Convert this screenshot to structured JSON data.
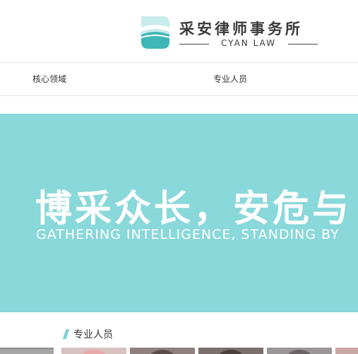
{
  "logo": {
    "name_cn": "采安律师事务所",
    "name_en": "CYAN LAW",
    "colors": {
      "mark_light": "#c8ebeb",
      "mark_dark": "#3fb7b6"
    }
  },
  "nav": {
    "items": [
      {
        "label": "核心领域"
      },
      {
        "label": "专业人员"
      }
    ]
  },
  "banner": {
    "title_cn": "博采众长，安危与",
    "title_en": "GATHERING INTELLIGENCE, STANDING BY",
    "background": "#89d8da"
  },
  "section": {
    "title": "专业人员",
    "accent": "#7fd2d4"
  }
}
